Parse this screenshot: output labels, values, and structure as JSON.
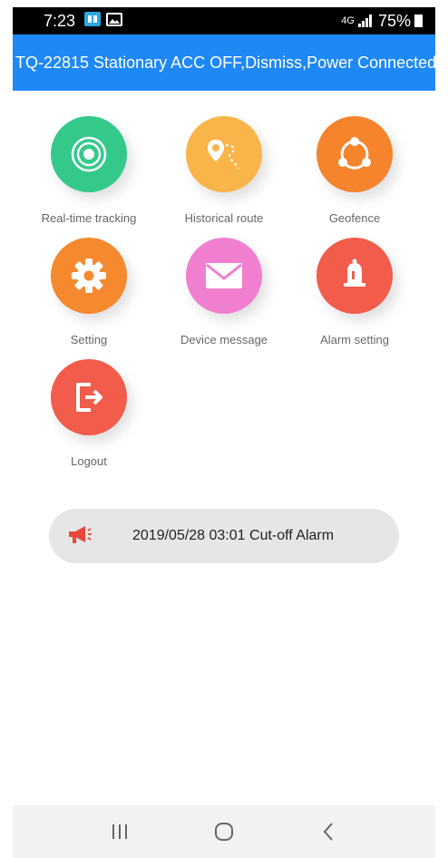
{
  "statusbar": {
    "time": "7:23",
    "network": "4G",
    "battery": "75%"
  },
  "banner": {
    "text": "TQ-22815 Stationary ACC OFF,Dismiss,Power Connected"
  },
  "menu": [
    {
      "label": "Real-time tracking",
      "icon": "target-icon",
      "color": "#34c98b"
    },
    {
      "label": "Historical route",
      "icon": "route-pin-icon",
      "color": "#f9b549"
    },
    {
      "label": "Geofence",
      "icon": "share-nodes-icon",
      "color": "#f5842c"
    },
    {
      "label": "Setting",
      "icon": "gear-icon",
      "color": "#f5892e"
    },
    {
      "label": "Device message",
      "icon": "envelope-icon",
      "color": "#f07fcf"
    },
    {
      "label": "Alarm setting",
      "icon": "bell-icon",
      "color": "#f15c4b"
    },
    {
      "label": "Logout",
      "icon": "logout-icon",
      "color": "#f15c4b"
    }
  ],
  "alarm": {
    "icon": "megaphone-icon",
    "text": "2019/05/28 03:01 Cut-off Alarm"
  },
  "navbar": {
    "recent": "recent-apps-icon",
    "home": "home-icon",
    "back": "back-icon"
  }
}
